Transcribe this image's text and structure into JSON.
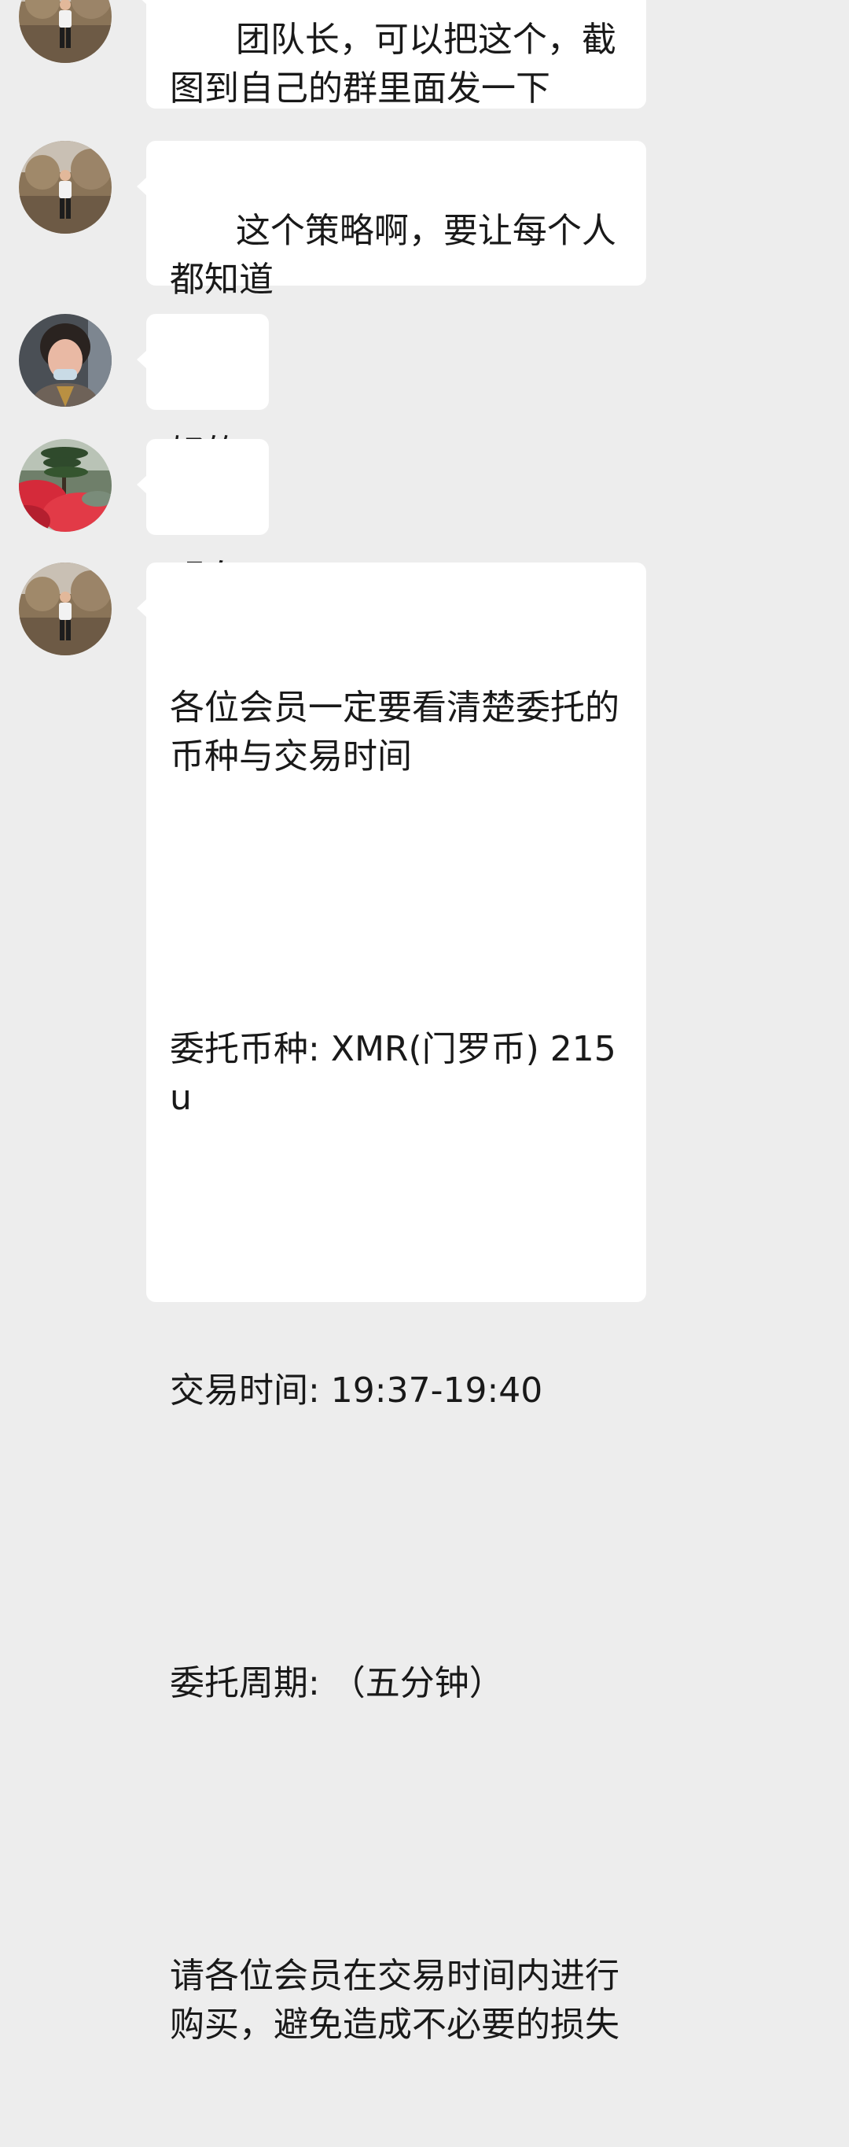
{
  "messages": [
    {
      "avatar": "man-avatar",
      "text": "团队长，可以把这个，截图到自己的群里面发一下"
    },
    {
      "avatar": "man-avatar",
      "text": "这个策略啊，要让每个人都知道"
    },
    {
      "avatar": "woman-avatar",
      "text": "好的"
    },
    {
      "avatar": "landscape-avatar",
      "text": "明白"
    },
    {
      "avatar": "man-avatar",
      "paragraphs": [
        "各位会员一定要看清楚委托的币种与交易时间",
        "委托币种: XMR(门罗币) 215u",
        "交易时间: 19:37-19:40",
        "委托周期: （五分钟）",
        "请各位会员在交易时间内进行购买，避免造成不必要的损失"
      ]
    }
  ],
  "colors": {
    "background": "#ededed",
    "bubble": "#ffffff",
    "text": "#191919"
  }
}
